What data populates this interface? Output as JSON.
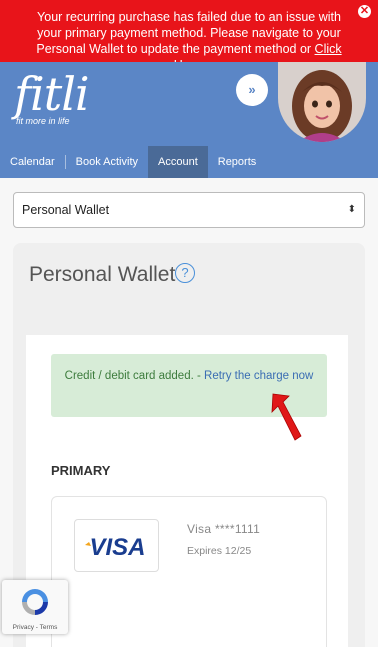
{
  "alert": {
    "message": "Your recurring purchase has failed due to an issue with your primary payment method. Please navigate to your Personal Wallet to update the payment method or",
    "link": "Click Here",
    "suffix": "."
  },
  "brand": {
    "name": "fitli",
    "tagline": "fit more in life"
  },
  "nav": {
    "items": [
      "Calendar",
      "Book Activity",
      "Account",
      "Reports"
    ],
    "active": "Account"
  },
  "wallet_select": {
    "value": "Personal Wallet"
  },
  "wallet": {
    "title": "Personal Wallet",
    "success_text": "Credit / debit card added. - ",
    "retry_link": "Retry the charge now",
    "primary_label": "PRIMARY",
    "card": {
      "brand": "VISA",
      "number": "Visa ****1111",
      "expires": "Expires 12/25"
    }
  },
  "recaptcha": {
    "privacy": "Privacy",
    "sep": " - ",
    "terms": "Terms"
  },
  "colors": {
    "alert": "#e8141a",
    "header": "#5b86c6",
    "success_bg": "#d7ecd7",
    "link": "#3a6db3"
  },
  "icons": [
    "close-icon",
    "chevron-double-down-icon",
    "help-icon",
    "select-arrows-icon",
    "visa-logo",
    "recaptcha-icon",
    "pointer-arrow-icon"
  ]
}
